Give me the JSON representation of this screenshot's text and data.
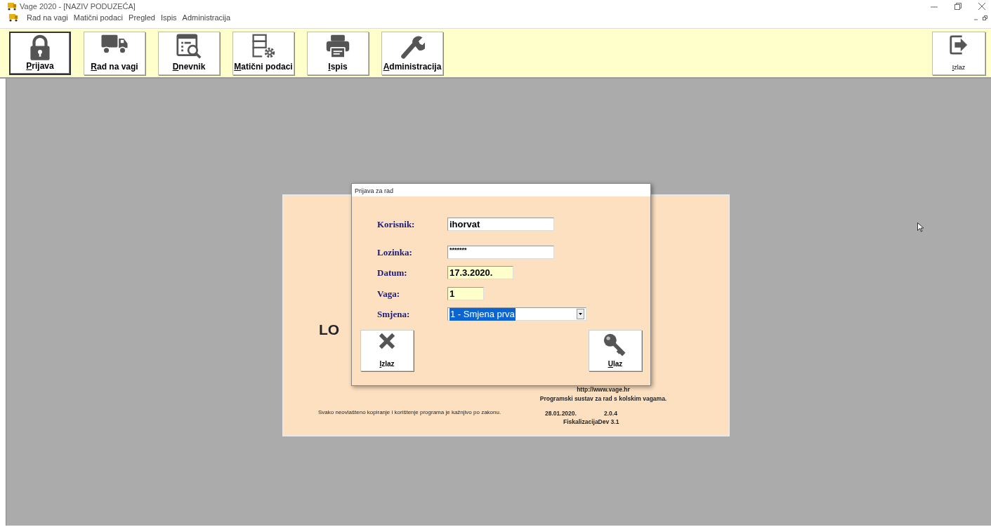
{
  "window": {
    "title": "Vage 2020 - [NAZIV PODUZEĆA]"
  },
  "menu": [
    "Rad na vagi",
    "Matični podaci",
    "Pregled",
    "Ispis",
    "Administracija"
  ],
  "toolbar": [
    {
      "label": "Prijava",
      "kind": "lock",
      "selected": true
    },
    {
      "label": "Rad na vagi",
      "kind": "truck",
      "selected": false
    },
    {
      "label": "Dnevnik",
      "kind": "journal",
      "selected": false
    },
    {
      "label": "Matični podaci",
      "kind": "data",
      "selected": false
    },
    {
      "label": "Ispis",
      "kind": "printer",
      "selected": false
    },
    {
      "label": "Administracija",
      "kind": "wrench",
      "selected": false
    }
  ],
  "exit_button": {
    "label": "Izlaz"
  },
  "splash": {
    "logo": "LO",
    "url": "http://www.vage.hr",
    "tagline": "Programski sustav za rad s kolskim vagama.",
    "notice": "Svako neovlašteno kopiranje i korištenje programa je kažnjivo po zakonu.",
    "date": "28.01.2020.",
    "version": "2.0.4",
    "build": "FiskalizacijaDev 3.1"
  },
  "dialog": {
    "title": "Prijava za rad",
    "fields": [
      {
        "label": "Korisnik:",
        "kind": "text",
        "value": "ihorvat",
        "highlighted": false
      },
      {
        "label": "Lozinka:",
        "kind": "password",
        "value": "*******",
        "highlighted": false
      },
      {
        "label": "Datum:",
        "kind": "date",
        "value": "17.3.2020.",
        "highlighted": true
      },
      {
        "label": "Vaga:",
        "kind": "short",
        "value": "1",
        "highlighted": true
      },
      {
        "label": "Smjena:",
        "kind": "select",
        "value": "1 - Smjena prva",
        "highlighted": false
      }
    ],
    "buttons": [
      {
        "label": "Izlaz",
        "kind": "cross"
      },
      {
        "label": "Ulaz",
        "kind": "key"
      }
    ]
  }
}
